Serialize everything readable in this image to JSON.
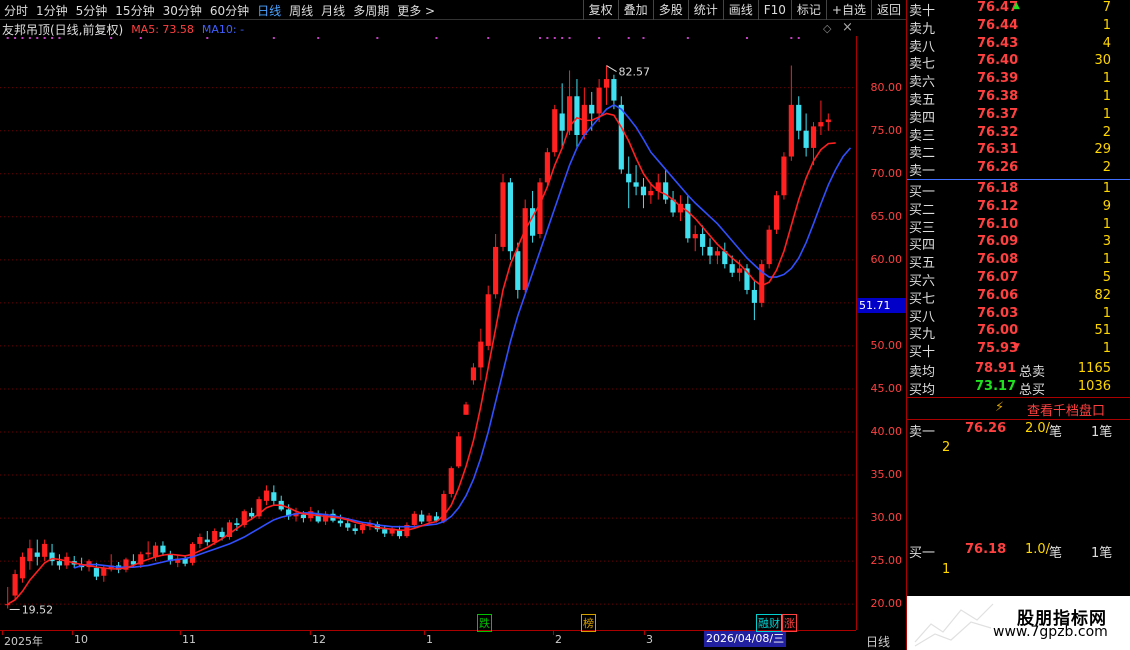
{
  "toolbar": {
    "periods": [
      "分时",
      "1分钟",
      "5分钟",
      "15分钟",
      "30分钟",
      "60分钟",
      "日线",
      "周线",
      "月线",
      "多周期",
      "更多 >"
    ],
    "active_period": "日线",
    "tools": [
      "复权",
      "叠加",
      "多股",
      "统计",
      "画线",
      "F10",
      "标记",
      "+自选",
      "返回"
    ]
  },
  "chart": {
    "indicator_name": "友邦吊顶(日线,前复权)",
    "ma5_label": "MA5: 73.58",
    "ma10_label": "MA10: -",
    "high_label": "82.57",
    "low_label": "19.52",
    "current_price": "51.71",
    "bottom_label": "日线",
    "date_highlight": "2026/04/08/三",
    "events": [
      {
        "text": "跌",
        "color": "#00c000"
      },
      {
        "text": "榜",
        "color": "#d4a000"
      },
      {
        "text": "融财",
        "color": "#00d0d0"
      },
      {
        "text": "涨",
        "color": "#ff4040"
      }
    ]
  },
  "chart_data": {
    "type": "candlestick",
    "ylim": [
      17,
      86
    ],
    "yticks": [
      20,
      25,
      30,
      35,
      40,
      45,
      50,
      55,
      60,
      65,
      70,
      75,
      80
    ],
    "x_labels": [
      "2025年",
      "10",
      "11",
      "12",
      "1",
      "2",
      "3"
    ],
    "colors": {
      "up": "#ff2020",
      "down": "#40e0f0",
      "ma5": "#ff2020",
      "ma10": "#3050ff"
    },
    "candles": [
      [
        20,
        22,
        19.5,
        20
      ],
      [
        21,
        24,
        20.5,
        23.5
      ],
      [
        23,
        26,
        22.5,
        25.5
      ],
      [
        25,
        27.5,
        24,
        26.5
      ],
      [
        26,
        27.5,
        24.5,
        25.5
      ],
      [
        25.5,
        27.5,
        25,
        27
      ],
      [
        26,
        27,
        24.5,
        25
      ],
      [
        25,
        25.8,
        24,
        24.5
      ],
      [
        24.5,
        26,
        24.1,
        25.5
      ],
      [
        25,
        25.6,
        24.2,
        24.6
      ],
      [
        24.6,
        25.4,
        23.9,
        24.3
      ],
      [
        24.3,
        25.2,
        23.8,
        25
      ],
      [
        24.2,
        24.8,
        22.8,
        23.2
      ],
      [
        23.3,
        24.5,
        22.6,
        24.2
      ],
      [
        24.2,
        25.8,
        23.8,
        24.5
      ],
      [
        24.5,
        24.9,
        23.6,
        24
      ],
      [
        24,
        25.4,
        23.7,
        25.2
      ],
      [
        25,
        25.8,
        24.3,
        24.6
      ],
      [
        24.6,
        26.1,
        24.2,
        25.8
      ],
      [
        25.8,
        27.3,
        25.4,
        26
      ],
      [
        25.5,
        27.2,
        25,
        26.8
      ],
      [
        26.8,
        27.3,
        25.6,
        26
      ],
      [
        25.8,
        26.2,
        24.6,
        25
      ],
      [
        24.8,
        25.7,
        24.3,
        25.3
      ],
      [
        25.3,
        25.6,
        24.4,
        24.7
      ],
      [
        24.8,
        27.2,
        24.5,
        27
      ],
      [
        27,
        28.2,
        26.5,
        27.8
      ],
      [
        27.5,
        28.5,
        26.8,
        27.2
      ],
      [
        27.2,
        28.8,
        26.9,
        28.5
      ],
      [
        28.4,
        28.9,
        27.4,
        27.8
      ],
      [
        27.8,
        29.8,
        27.5,
        29.5
      ],
      [
        29.4,
        30,
        28.5,
        29.2
      ],
      [
        29.2,
        31,
        28.9,
        30.8
      ],
      [
        30.6,
        31.2,
        29.8,
        30.2
      ],
      [
        30.2,
        32.5,
        29.9,
        32.2
      ],
      [
        32,
        33.8,
        31.5,
        33.2
      ],
      [
        33,
        33.8,
        31.5,
        32
      ],
      [
        32,
        32.6,
        30.8,
        31
      ],
      [
        31,
        31.6,
        29.8,
        30.2
      ],
      [
        30.2,
        31.2,
        29.6,
        30.6
      ],
      [
        30.4,
        30.8,
        29.5,
        30
      ],
      [
        30,
        31.3,
        29.6,
        30.8
      ],
      [
        30.5,
        30.9,
        29.4,
        29.6
      ],
      [
        29.6,
        30.8,
        29.2,
        30.5
      ],
      [
        30.5,
        31,
        29.5,
        29.7
      ],
      [
        29.7,
        30.4,
        29,
        29.4
      ],
      [
        29.4,
        30,
        28.5,
        28.9
      ],
      [
        28.8,
        29.3,
        28.1,
        28.5
      ],
      [
        28.6,
        29.5,
        28.2,
        29.2
      ],
      [
        29.2,
        29.8,
        28.6,
        29.4
      ],
      [
        29.3,
        29.6,
        28.4,
        28.7
      ],
      [
        28.7,
        29.2,
        27.8,
        28.2
      ],
      [
        28.2,
        29,
        27.9,
        28.8
      ],
      [
        28.6,
        29.1,
        27.6,
        27.9
      ],
      [
        27.9,
        29.5,
        27.7,
        29.2
      ],
      [
        29.2,
        30.8,
        28.9,
        30.5
      ],
      [
        30.4,
        30.9,
        29.3,
        29.6
      ],
      [
        29.6,
        30.6,
        29.3,
        30.3
      ],
      [
        30.2,
        30.7,
        29.5,
        29.7
      ],
      [
        29.6,
        33.2,
        29.4,
        32.8
      ],
      [
        32.8,
        36,
        32.4,
        35.8
      ],
      [
        36,
        40,
        35.8,
        39.5
      ],
      [
        42,
        43.5,
        42,
        43.2
      ],
      [
        46,
        48,
        45.5,
        47.5
      ],
      [
        47.5,
        52,
        46,
        50.5
      ],
      [
        50,
        57,
        49.5,
        56
      ],
      [
        56,
        63,
        55.5,
        61.5
      ],
      [
        61.5,
        70,
        61,
        69
      ],
      [
        69,
        69.5,
        60,
        61
      ],
      [
        61,
        62,
        55.5,
        56.5
      ],
      [
        56.5,
        67,
        56.2,
        66
      ],
      [
        66,
        68,
        62,
        62.8
      ],
      [
        63,
        69.5,
        62.5,
        69
      ],
      [
        69,
        73,
        68.5,
        72.5
      ],
      [
        72.5,
        78,
        72,
        77.5
      ],
      [
        77,
        80.5,
        73,
        75
      ],
      [
        75,
        82,
        74.5,
        79
      ],
      [
        79,
        81,
        73,
        74.5
      ],
      [
        74.5,
        80,
        74,
        78
      ],
      [
        78,
        79.5,
        75,
        77
      ],
      [
        77,
        81,
        76,
        80
      ],
      [
        80,
        82.57,
        78,
        81
      ],
      [
        81,
        81.5,
        77.5,
        78.5
      ],
      [
        78,
        79,
        70,
        70.5
      ],
      [
        70,
        72,
        66,
        69
      ],
      [
        69,
        71,
        67.5,
        68.5
      ],
      [
        68.5,
        69.5,
        66,
        67.5
      ],
      [
        67.5,
        69,
        66.5,
        68
      ],
      [
        68,
        70,
        67,
        69
      ],
      [
        69,
        70.5,
        66.5,
        67
      ],
      [
        67,
        68,
        65,
        65.5
      ],
      [
        65.5,
        67.5,
        64.5,
        66.5
      ],
      [
        66.5,
        67.5,
        62,
        62.5
      ],
      [
        62.5,
        64,
        61,
        63
      ],
      [
        63,
        64,
        60.5,
        61.5
      ],
      [
        61.5,
        62.5,
        59.5,
        60.5
      ],
      [
        60.5,
        61.5,
        59.5,
        61
      ],
      [
        61,
        62,
        59,
        59.5
      ],
      [
        59.5,
        60.5,
        58,
        58.5
      ],
      [
        58.5,
        60,
        57.5,
        59
      ],
      [
        59,
        59.5,
        56,
        56.5
      ],
      [
        56.5,
        57.5,
        53,
        55
      ],
      [
        55,
        60,
        54.5,
        59.5
      ],
      [
        59.5,
        64,
        59,
        63.5
      ],
      [
        63.5,
        68,
        63,
        67.5
      ],
      [
        67.5,
        72.5,
        67,
        72
      ],
      [
        72,
        82.57,
        71.5,
        78
      ],
      [
        78,
        79,
        74,
        75
      ],
      [
        75,
        77,
        72,
        73
      ],
      [
        73,
        76,
        71,
        75.5
      ],
      [
        75.5,
        78.5,
        74.5,
        76
      ],
      [
        76,
        77,
        75,
        76.3
      ]
    ],
    "ma5": [
      20,
      20.5,
      21.5,
      22.8,
      23.8,
      24.8,
      25.3,
      25.2,
      25,
      24.8,
      24.6,
      24.5,
      24.3,
      24.2,
      24.1,
      24.1,
      24.2,
      24.5,
      24.9,
      25.2,
      25.5,
      25.7,
      25.8,
      25.7,
      25.6,
      25.8,
      26.2,
      26.6,
      27.1,
      27.6,
      28.2,
      28.8,
      29.4,
      29.9,
      30.5,
      31.2,
      31.5,
      31.5,
      31.2,
      30.8,
      30.5,
      30.4,
      30.3,
      30.2,
      30.1,
      30,
      29.8,
      29.5,
      29.3,
      29.1,
      28.9,
      28.8,
      28.7,
      28.6,
      28.6,
      28.8,
      29.1,
      29.4,
      29.6,
      30.3,
      31.5,
      33.5,
      36,
      39,
      43,
      47.5,
      52,
      56.5,
      59.5,
      61.5,
      63.5,
      65,
      66.5,
      68.5,
      71,
      73,
      75.5,
      76.5,
      76.2,
      76.2,
      76.6,
      77,
      76.8,
      75.4,
      73.8,
      71.8,
      70,
      68.8,
      68,
      67.6,
      67,
      66.2,
      65.6,
      64.8,
      63.8,
      62.8,
      61.8,
      61,
      60.2,
      59.5,
      58.6,
      57.6,
      57,
      57.4,
      58.8,
      61,
      64,
      67,
      69.5,
      71.5,
      72.8,
      73.5,
      73.58
    ],
    "ma10": [
      null,
      null,
      null,
      null,
      null,
      null,
      null,
      null,
      null,
      24.2,
      24.5,
      24.6,
      24.6,
      24.5,
      24.4,
      24.3,
      24.3,
      24.3,
      24.4,
      24.5,
      24.7,
      24.9,
      25.1,
      25.2,
      25.3,
      25.5,
      25.8,
      26.1,
      26.4,
      26.7,
      27,
      27.4,
      27.8,
      28.3,
      28.8,
      29.3,
      29.8,
      30.1,
      30.3,
      30.5,
      30.6,
      30.6,
      30.5,
      30.4,
      30.3,
      30.1,
      29.9,
      29.7,
      29.5,
      29.4,
      29.2,
      29.1,
      29,
      29,
      29,
      29,
      29.1,
      29.2,
      29.3,
      29.6,
      30.2,
      31.2,
      32.6,
      34.5,
      37,
      40,
      43.5,
      47,
      50.5,
      53.5,
      56,
      58.5,
      61,
      63.5,
      66,
      68.5,
      71,
      73,
      74.5,
      75.5,
      76.5,
      77.5,
      78,
      77.5,
      76.5,
      75.4,
      74,
      72.5,
      71.5,
      70.5,
      69.5,
      68.5,
      67.5,
      66.6,
      65.8,
      65,
      64.2,
      63.2,
      62.2,
      61.2,
      60.2,
      59.4,
      58.6,
      58,
      58,
      58.3,
      59,
      60.2,
      62,
      64.2,
      66.5,
      68.7,
      70.5,
      72,
      73
    ]
  },
  "orderbook": {
    "asks": [
      {
        "label": "卖十",
        "price": "76.47",
        "vol": "7",
        "mark": "*"
      },
      {
        "label": "卖九",
        "price": "76.44",
        "vol": "1",
        "mark": ""
      },
      {
        "label": "卖八",
        "price": "76.43",
        "vol": "4",
        "mark": ""
      },
      {
        "label": "卖七",
        "price": "76.40",
        "vol": "30",
        "mark": ""
      },
      {
        "label": "卖六",
        "price": "76.39",
        "vol": "1",
        "mark": ""
      },
      {
        "label": "卖五",
        "price": "76.38",
        "vol": "1",
        "mark": ""
      },
      {
        "label": "卖四",
        "price": "76.37",
        "vol": "1",
        "mark": ""
      },
      {
        "label": "卖三",
        "price": "76.32",
        "vol": "2",
        "mark": ""
      },
      {
        "label": "卖二",
        "price": "76.31",
        "vol": "29",
        "mark": ""
      },
      {
        "label": "卖一",
        "price": "76.26",
        "vol": "2",
        "mark": ""
      }
    ],
    "bids": [
      {
        "label": "买一",
        "price": "76.18",
        "vol": "1",
        "mark": ""
      },
      {
        "label": "买二",
        "price": "76.12",
        "vol": "9",
        "mark": ""
      },
      {
        "label": "买三",
        "price": "76.10",
        "vol": "1",
        "mark": ""
      },
      {
        "label": "买四",
        "price": "76.09",
        "vol": "3",
        "mark": ""
      },
      {
        "label": "买五",
        "price": "76.08",
        "vol": "1",
        "mark": ""
      },
      {
        "label": "买六",
        "price": "76.07",
        "vol": "5",
        "mark": ""
      },
      {
        "label": "买七",
        "price": "76.06",
        "vol": "82",
        "mark": ""
      },
      {
        "label": "买八",
        "price": "76.03",
        "vol": "1",
        "mark": ""
      },
      {
        "label": "买九",
        "price": "76.00",
        "vol": "51",
        "mark": ""
      },
      {
        "label": "买十",
        "price": "75.93",
        "vol": "1",
        "mark": "v"
      }
    ],
    "summary": {
      "ask_avg_label": "卖均",
      "ask_avg": "78.91",
      "ask_total_label": "总卖",
      "ask_total": "1165",
      "bid_avg_label": "买均",
      "bid_avg": "73.17",
      "bid_total_label": "总买",
      "bid_total": "1036"
    },
    "view_thousand": "查看千档盘口",
    "queue": {
      "ask_label": "卖一",
      "ask_price": "76.26",
      "ask_per": "2.0/",
      "ask_unit": "笔",
      "ask_count": "1笔",
      "ask_detail": "2",
      "bid_label": "买一",
      "bid_price": "76.18",
      "bid_per": "1.0/",
      "bid_unit": "笔",
      "bid_count": "1笔",
      "bid_detail": "1"
    }
  },
  "watermark": {
    "title": "股朋指标网",
    "url": "www.7gpzb.com"
  }
}
